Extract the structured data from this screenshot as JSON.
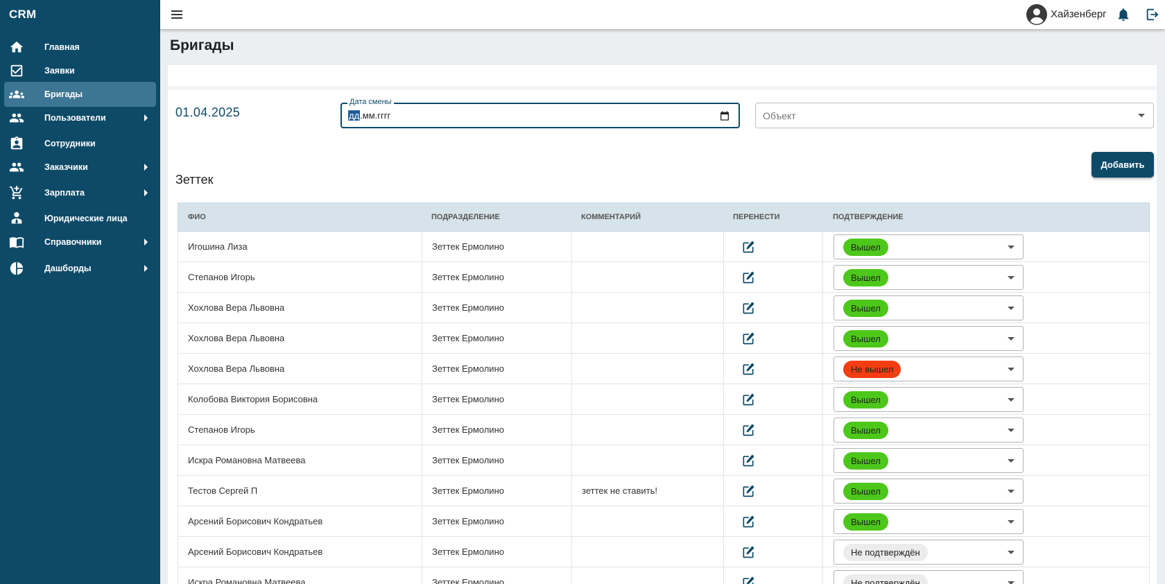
{
  "app": {
    "logo": "CRM"
  },
  "sidebar": {
    "items": [
      {
        "label": "Главная",
        "icon": "home-icon",
        "active": false,
        "has_submenu": false
      },
      {
        "label": "Заявки",
        "icon": "checkbox-icon",
        "active": false,
        "has_submenu": false
      },
      {
        "label": "Бригады",
        "icon": "group-icon",
        "active": true,
        "has_submenu": false
      },
      {
        "label": "Пользователи",
        "icon": "people-icon",
        "active": false,
        "has_submenu": true
      },
      {
        "label": "Сотрудники",
        "icon": "badge-icon",
        "active": false,
        "has_submenu": false
      },
      {
        "label": "Заказчики",
        "icon": "people-icon",
        "active": false,
        "has_submenu": true
      },
      {
        "label": "Зарплата",
        "icon": "cart-icon",
        "active": false,
        "has_submenu": true
      },
      {
        "label": "Юридические лица",
        "icon": "person-tie-icon",
        "active": false,
        "has_submenu": false
      },
      {
        "label": "Справочники",
        "icon": "book-icon",
        "active": false,
        "has_submenu": true
      },
      {
        "label": "Дашборды",
        "icon": "pie-chart-icon",
        "active": false,
        "has_submenu": true
      }
    ]
  },
  "topbar": {
    "username": "Хайзенберг"
  },
  "page": {
    "title": "Бригады"
  },
  "filters": {
    "shift_date_display": "01.04.2025",
    "date_field_label": "Дата смены",
    "date_field_selected_segment": "дд",
    "date_field_rest": ".мм.гггг",
    "object_placeholder": "Объект"
  },
  "actions": {
    "add_label": "Добавить"
  },
  "group": {
    "title": "Зеттек"
  },
  "table": {
    "columns": [
      "ФИО",
      "ПОДРАЗДЕЛЕНИЕ",
      "КОММЕНТАРИЙ",
      "ПЕРЕНЕСТИ",
      "ПОДТВЕРЖДЕНИЕ"
    ],
    "rows": [
      {
        "name": "Игошина Лиза",
        "division": "Зеттек Ермолино",
        "comment": "",
        "status": "Вышел",
        "status_type": "out"
      },
      {
        "name": "Степанов Игорь",
        "division": "Зеттек Ермолино",
        "comment": "",
        "status": "Вышел",
        "status_type": "out"
      },
      {
        "name": "Хохлова Вера Львовна",
        "division": "Зеттек Ермолино",
        "comment": "",
        "status": "Вышел",
        "status_type": "out"
      },
      {
        "name": "Хохлова Вера Львовна",
        "division": "Зеттек Ермолино",
        "comment": "",
        "status": "Вышел",
        "status_type": "out"
      },
      {
        "name": "Хохлова Вера Львовна",
        "division": "Зеттек Ермолино",
        "comment": "",
        "status": "Не вышел",
        "status_type": "absent"
      },
      {
        "name": "Колобова Виктория Борисовна",
        "division": "Зеттек Ермолино",
        "comment": "",
        "status": "Вышел",
        "status_type": "out"
      },
      {
        "name": "Степанов Игорь",
        "division": "Зеттек Ермолино",
        "comment": "",
        "status": "Вышел",
        "status_type": "out"
      },
      {
        "name": "Искра Романовна Матвеева",
        "division": "Зеттек Ермолино",
        "comment": "",
        "status": "Вышел",
        "status_type": "out"
      },
      {
        "name": "Тестов Сергей П",
        "division": "Зеттек Ермолино",
        "comment": "зеттек не ставить!",
        "status": "Вышел",
        "status_type": "out"
      },
      {
        "name": "Арсений Борисович Кондратьев",
        "division": "Зеттек Ермолино",
        "comment": "",
        "status": "Вышел",
        "status_type": "out"
      },
      {
        "name": "Арсений Борисович Кондратьев",
        "division": "Зеттек Ермолино",
        "comment": "",
        "status": "Не подтверждён",
        "status_type": "pending"
      },
      {
        "name": "Искра Романовна Матвеева",
        "division": "Зеттек Ермолино",
        "comment": "",
        "status": "Не подтверждён",
        "status_type": "pending"
      }
    ]
  },
  "colors": {
    "sidebar_bg": "#0d4a68",
    "sidebar_active": "#3d7594",
    "accent": "#0d4a68",
    "status_out": "#4cc71a",
    "status_absent": "#f53d12",
    "status_pending": "#ececec"
  }
}
